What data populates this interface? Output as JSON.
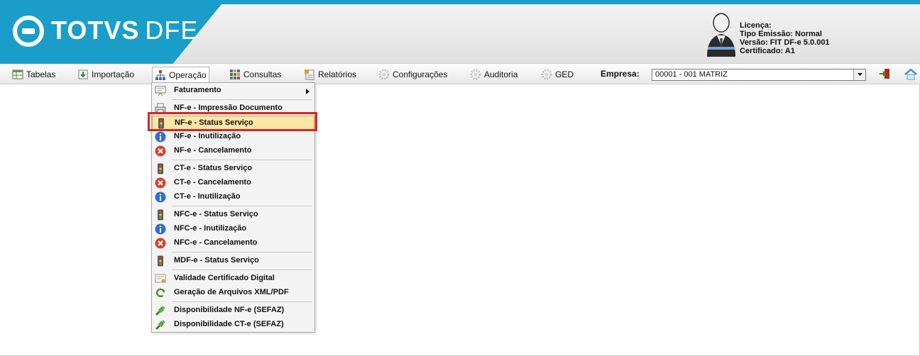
{
  "brand": {
    "name": "TOTVS",
    "product": "DFE"
  },
  "license": {
    "license_label": "Licença:",
    "emission": "Tipo Emissão: Normal",
    "version": "Versão: FIT DF-e 5.0.001",
    "certificate": "Certificado: A1"
  },
  "menu": {
    "items": [
      {
        "label": "Tabelas",
        "icon": "table-icon"
      },
      {
        "label": "Importação",
        "icon": "import-icon"
      },
      {
        "label": "Operação",
        "icon": "org-chart-icon"
      },
      {
        "label": "Consultas",
        "icon": "grid-icon"
      },
      {
        "label": "Relatórios",
        "icon": "report-icon"
      },
      {
        "label": "Configurações",
        "icon": "gear-icon"
      },
      {
        "label": "Auditoria",
        "icon": "gear-icon"
      },
      {
        "label": "GED",
        "icon": "gear-icon"
      }
    ],
    "active_item": "Operação",
    "empresa_label": "Empresa:",
    "empresa_value": "00001 - 001 MATRIZ"
  },
  "dropdown": {
    "items": [
      {
        "label": "Faturamento",
        "icon": "billing-icon"
      },
      {
        "label": "NF-e - Impressão Documento",
        "icon": "printer-icon"
      },
      {
        "label": "NF-e - Status Serviço",
        "icon": "traffic-light-icon"
      },
      {
        "label": "NF-e - Inutilização",
        "icon": "info-icon"
      },
      {
        "label": "NF-e - Cancelamento",
        "icon": "cancel-icon"
      },
      {
        "label": "CT-e - Status Serviço",
        "icon": "traffic-light-icon"
      },
      {
        "label": "CT-e - Cancelamento",
        "icon": "cancel-icon"
      },
      {
        "label": "CT-e - Inutilização",
        "icon": "info-icon"
      },
      {
        "label": "NFC-e - Status Serviço",
        "icon": "traffic-light-icon"
      },
      {
        "label": "NFC-e - Inutilização",
        "icon": "info-icon"
      },
      {
        "label": "NFC-e - Cancelamento",
        "icon": "cancel-icon"
      },
      {
        "label": "MDF-e - Status Serviço",
        "icon": "traffic-light-icon"
      },
      {
        "label": "Validade Certificado Digital",
        "icon": "certificate-icon"
      },
      {
        "label": "Geração de Arquivos XML/PDF",
        "icon": "refresh-icon"
      },
      {
        "label": "Disponibilidade NF-e (SEFAZ)",
        "icon": "plug-icon"
      },
      {
        "label": "Disponibilidade CT-e (SEFAZ)",
        "icon": "plug-icon"
      }
    ],
    "highlighted_item": "NF-e - Status Serviço"
  },
  "colors": {
    "brand": "#1a9ec9",
    "highlight": "#fbe7a7",
    "callout": "#e0211f"
  }
}
